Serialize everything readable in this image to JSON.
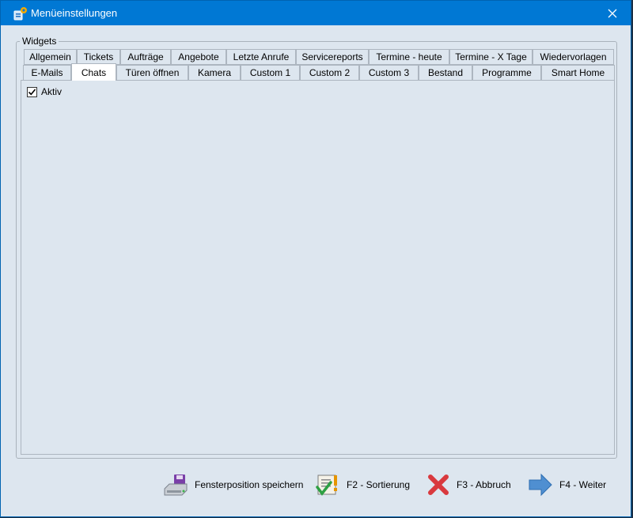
{
  "window": {
    "title": "Menüeinstellungen",
    "accent": "#0078d4"
  },
  "group": {
    "legend": "Widgets"
  },
  "tabs_row1": [
    {
      "label": "Allgemein"
    },
    {
      "label": "Tickets"
    },
    {
      "label": "Aufträge"
    },
    {
      "label": "Angebote"
    },
    {
      "label": "Letzte Anrufe"
    },
    {
      "label": "Servicereports"
    },
    {
      "label": "Termine - heute"
    },
    {
      "label": "Termine - X Tage"
    },
    {
      "label": "Wiedervorlagen"
    }
  ],
  "tabs_row2": [
    {
      "label": "E-Mails"
    },
    {
      "label": "Chats",
      "active": true
    },
    {
      "label": "Türen öffnen"
    },
    {
      "label": "Kamera"
    },
    {
      "label": "Custom 1"
    },
    {
      "label": "Custom 2"
    },
    {
      "label": "Custom 3"
    },
    {
      "label": "Bestand"
    },
    {
      "label": "Programme"
    },
    {
      "label": "Smart Home"
    }
  ],
  "panel": {
    "checkbox_label": "Aktiv",
    "checked": true
  },
  "buttons": {
    "save_position": "Fensterposition speichern",
    "sort": "F2 - Sortierung",
    "cancel": "F3 - Abbruch",
    "next": "F4 - Weiter"
  }
}
